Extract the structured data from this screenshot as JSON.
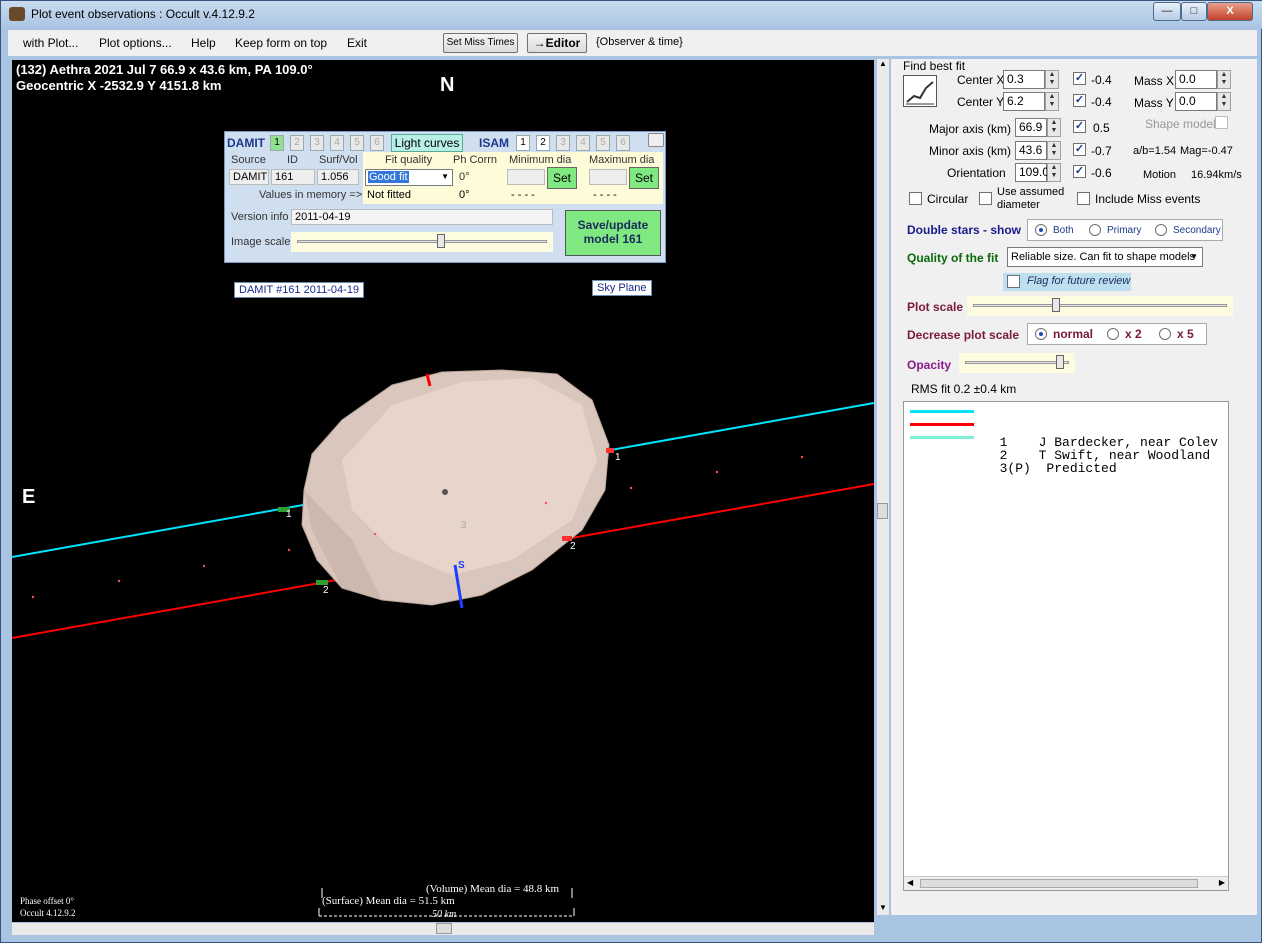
{
  "window": {
    "title": "Plot event observations : Occult v.4.12.9.2",
    "min": "—",
    "max": "□",
    "close": "X"
  },
  "menu": [
    "with Plot...",
    "Plot options...",
    "Help",
    "Keep form on top",
    "Exit"
  ],
  "toolbar": {
    "set_miss_times": "Set Miss Times",
    "editor": "→Editor",
    "observer_time": "{Observer & time}"
  },
  "plot": {
    "header1": "(132) Aethra  2021 Jul 7  66.9 x 43.6 km, PA 109.0°",
    "header2": "Geocentric  X  -2532.9  Y 4151.8 km",
    "north": "N",
    "east": "E",
    "damit_label": "DAMIT #161 2011-04-19",
    "sky_plane": "Sky Plane",
    "volume_mean": "(Volume) Mean dia = 48.8 km",
    "surface_mean": "(Surface) Mean dia = 51.5 km",
    "scale_bar": "50 km",
    "phase_offset": "Phase offset 0°",
    "version": "Occult 4.12.9.2",
    "chord_labels": [
      "1",
      "1",
      "2",
      "2",
      "3",
      "S"
    ]
  },
  "damit_panel": {
    "damit_title": "DAMIT",
    "tabs": [
      "1",
      "2",
      "3",
      "4",
      "5",
      "6"
    ],
    "light_curves": "Light curves",
    "isam_title": "ISAM",
    "source_hdr": "Source",
    "id_hdr": "ID",
    "surfvol_hdr": "Surf/Vol",
    "fit_quality_hdr": "Fit quality",
    "ph_corrn_hdr": "Ph Corrn",
    "min_dia_hdr": "Minimum dia",
    "max_dia_hdr": "Maximum dia",
    "source": "DAMIT",
    "id": "161",
    "surfvol": "1.056",
    "fit_quality": "Good fit",
    "ph_corrn": "0°",
    "set": "Set",
    "values_in_memory": "Values in memory =>",
    "not_fitted": "Not fitted",
    "ph_mem": "0°",
    "dash": "- - - -",
    "version_info_lbl": "Version info",
    "version_info": "2011-04-19",
    "image_scale_lbl": "Image scale",
    "save_update": "Save/update model 161"
  },
  "right_panel": {
    "find_best_fit": "Find best fit",
    "center_x_lbl": "Center X",
    "center_x": "0.3",
    "center_x_delta": "-0.4",
    "center_y_lbl": "Center Y",
    "center_y": "6.2",
    "center_y_delta": "-0.4",
    "mass_x_lbl": "Mass X",
    "mass_x": "0.0",
    "mass_y_lbl": "Mass Y",
    "mass_y": "0.0",
    "major_lbl": "Major axis (km)",
    "major": "66.9",
    "major_delta": "0.5",
    "minor_lbl": "Minor axis (km)",
    "minor": "43.6",
    "minor_delta": "-0.7",
    "orient_lbl": "Orientation",
    "orient": "109.0",
    "orient_delta": "-0.6",
    "shape_model": "Shape model",
    "ab_ratio": "a/b=1.54",
    "mag": "Mag=-0.47",
    "motion_lbl": "Motion",
    "motion": "16.94km/s",
    "circular": "Circular",
    "use_assumed": "Use assumed diameter",
    "include_miss": "Include Miss events",
    "double_stars": "Double stars - show",
    "both": "Both",
    "primary": "Primary",
    "secondary": "Secondary",
    "quality_lbl": "Quality of the fit",
    "quality_value": "Reliable size. Can fit to shape models",
    "flag_review": "Flag for future review",
    "plot_scale": "Plot scale",
    "decrease_scale": "Decrease plot scale",
    "normal": "normal",
    "x2": "x 2",
    "x5": "x 5",
    "opacity": "Opacity",
    "rms_fit": "RMS fit 0.2 ±0.4 km"
  },
  "legend": [
    {
      "text": "  1    J Bardecker, near Colev",
      "color": "#00e5ff"
    },
    {
      "text": "  2    T Swift, near Woodland ",
      "color": "#ff0000"
    },
    {
      "text": "  3(P)  Predicted",
      "color": "#7ff0d8"
    }
  ],
  "sliders": {
    "image_scale": 0.58,
    "plot_scale": 0.32,
    "opacity": 0.95
  },
  "colors": {
    "chord1": "#00e5ff",
    "chord2": "#ff0000",
    "asteroid": "#d9c6bd",
    "panel_bg": "#cfdff0"
  }
}
